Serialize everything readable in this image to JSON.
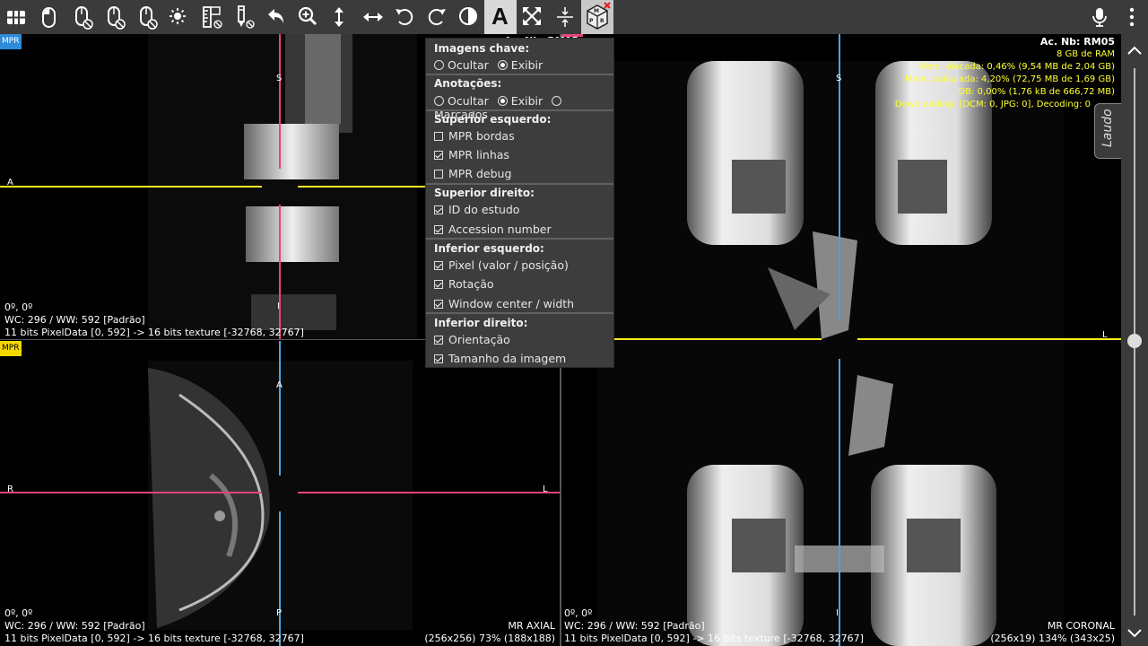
{
  "toolbar": {
    "buttons": [
      {
        "id": "layout-icon"
      },
      {
        "id": "mouse-left-icon"
      },
      {
        "id": "mouse-middle-icon"
      },
      {
        "id": "mouse-right-icon"
      },
      {
        "id": "mouse-scroll-icon"
      },
      {
        "id": "brightness-icon"
      },
      {
        "id": "ruler-icon"
      },
      {
        "id": "pencil-icon"
      },
      {
        "id": "undo-icon"
      },
      {
        "id": "zoom-icon"
      },
      {
        "id": "move-vertical-icon"
      },
      {
        "id": "move-horizontal-icon"
      },
      {
        "id": "rotate-left-icon"
      },
      {
        "id": "rotate-right-icon"
      },
      {
        "id": "contrast-icon"
      },
      {
        "id": "annotation-text-icon"
      },
      {
        "id": "fullscreen-icon"
      },
      {
        "id": "compress-vertical-icon"
      },
      {
        "id": "mpr-cube-icon"
      }
    ],
    "mpr_cube_label": "MPR",
    "text_tool_label": "A"
  },
  "colors": {
    "toolbar_bg": "#3b3b3b",
    "axis_yellow": "#ffee22",
    "axis_pink": "#e8457a",
    "axis_blue": "#4aa3e0",
    "overlay_yellow": "#ffff33",
    "menu_bg": "#3d3d3d"
  },
  "viewports": {
    "top_left": {
      "tag": "MPR",
      "tag_color": "#2e8bd8",
      "orient": {
        "top": "S",
        "left": "A",
        "bottom": "I"
      },
      "angles": "0º, 0º",
      "wc_ww": "WC: 296 / WW: 592 [Padrão]",
      "pixel_info": "11 bits PixelData [0, 592] -> 16 bits texture [-32768, 32767]"
    },
    "bottom_left": {
      "tag": "MPR",
      "tag_color": "#f5d800",
      "orient": {
        "top": "A",
        "left": "R",
        "right": "L",
        "bottom": "P"
      },
      "angles": "0º, 0º",
      "wc_ww": "WC: 296 / WW: 592 [Padrão]",
      "pixel_info": "11 bits PixelData [0, 592] -> 16 bits texture [-32768, 32767]",
      "series": "MR AXIAL",
      "size": "(256x256) 73% (188x188)"
    },
    "right": {
      "orient": {
        "top": "S",
        "right": "L",
        "bottom": "I"
      },
      "accession": "Ac. Nb: RM05",
      "ram": "8 GB de RAM",
      "mem_alloc": "Mem. alocada: 0,46% (9,54 MB de 2,04 GB)",
      "mem_calc": "Mem. calculada: 4,20% (72,75 MB de 1,69 GB)",
      "db": "DB: 0,00% (1,76 kB de 666,72 MB)",
      "downloading": "Downloading: [DCM: 0, JPG: 0], Decoding: 0",
      "angles": "0º, 0º",
      "wc_ww": "WC: 296 / WW: 592 [Padrão]",
      "pixel_info": "11 bits PixelData [0, 592] -> 16 bits texture [-32768, 32767]",
      "series": "MR CORONAL",
      "size": "(256x19) 134% (343x25)"
    },
    "partial_top_text": "Ac. Nb: RM05"
  },
  "menu": {
    "imagens_chave": {
      "title": "Imagens chave:",
      "options": [
        "Ocultar",
        "Exibir"
      ],
      "selected": "Exibir"
    },
    "anotacoes": {
      "title": "Anotações:",
      "options": [
        "Ocultar",
        "Exibir",
        "Marcados"
      ],
      "selected": "Exibir"
    },
    "superior_esquerdo": {
      "title": "Superior esquerdo:",
      "items": [
        {
          "label": "MPR bordas",
          "checked": false
        },
        {
          "label": "MPR linhas",
          "checked": true
        },
        {
          "label": "MPR debug",
          "checked": false
        }
      ]
    },
    "superior_direito": {
      "title": "Superior direito:",
      "items": [
        {
          "label": "ID do estudo",
          "checked": true
        },
        {
          "label": "Accession number",
          "checked": true
        }
      ]
    },
    "inferior_esquerdo": {
      "title": "Inferior esquerdo:",
      "items": [
        {
          "label": "Pixel (valor / posição)",
          "checked": true
        },
        {
          "label": "Rotação",
          "checked": true
        },
        {
          "label": "Window center / width",
          "checked": true
        }
      ]
    },
    "inferior_direito": {
      "title": "Inferior direito:",
      "items": [
        {
          "label": "Orientação",
          "checked": true
        },
        {
          "label": "Tamanho da imagem",
          "checked": true
        }
      ]
    }
  },
  "laudo": {
    "label": "Laudo"
  },
  "right_controls": {
    "mic": "microphone-icon",
    "more": "more-vertical-icon"
  }
}
